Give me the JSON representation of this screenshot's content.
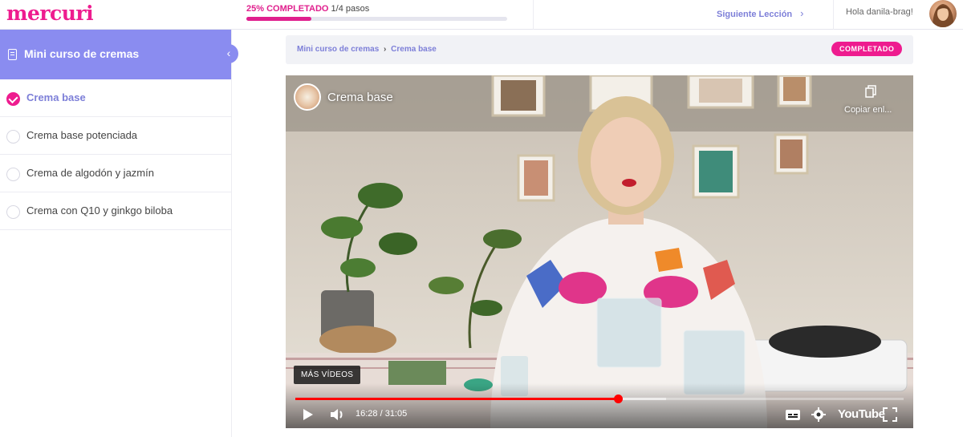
{
  "app": {
    "logo": "mercuri"
  },
  "header": {
    "progress_percent_label": "25% COMPLETADO",
    "progress_steps": "1/4 pasos",
    "progress_value": 0.25,
    "next_lesson_label": "Siguiente Lección",
    "greeting": "Hola danila-brag!",
    "avatar_icon": "user-avatar"
  },
  "sidebar": {
    "title": "Mini curso de cremas",
    "collapse_icon": "chevron-left-icon",
    "lessons": [
      {
        "label": "Crema base",
        "completed": true
      },
      {
        "label": "Crema base potenciada",
        "completed": false
      },
      {
        "label": "Crema de algodón y jazmín",
        "completed": false
      },
      {
        "label": "Crema con Q10 y ginkgo biloba",
        "completed": false
      }
    ]
  },
  "main": {
    "breadcrumb": {
      "course": "Mini curso de cremas",
      "separator": "›",
      "lesson": "Crema base"
    },
    "status_badge": "COMPLETADO"
  },
  "video": {
    "title": "Crema base",
    "copy_link_label": "Copiar enl...",
    "more_videos_label": "MÁS VÍDEOS",
    "time_display": "16:28 / 31:05",
    "progress_fraction": 0.53,
    "buffered_fraction": 0.61,
    "platform": "YouTube",
    "colors": {
      "progress": "#ff0000"
    }
  },
  "colors": {
    "brand_pink": "#ee1c8f",
    "accent_purple": "#8a8cf0",
    "link_purple": "#7d7fd8"
  }
}
